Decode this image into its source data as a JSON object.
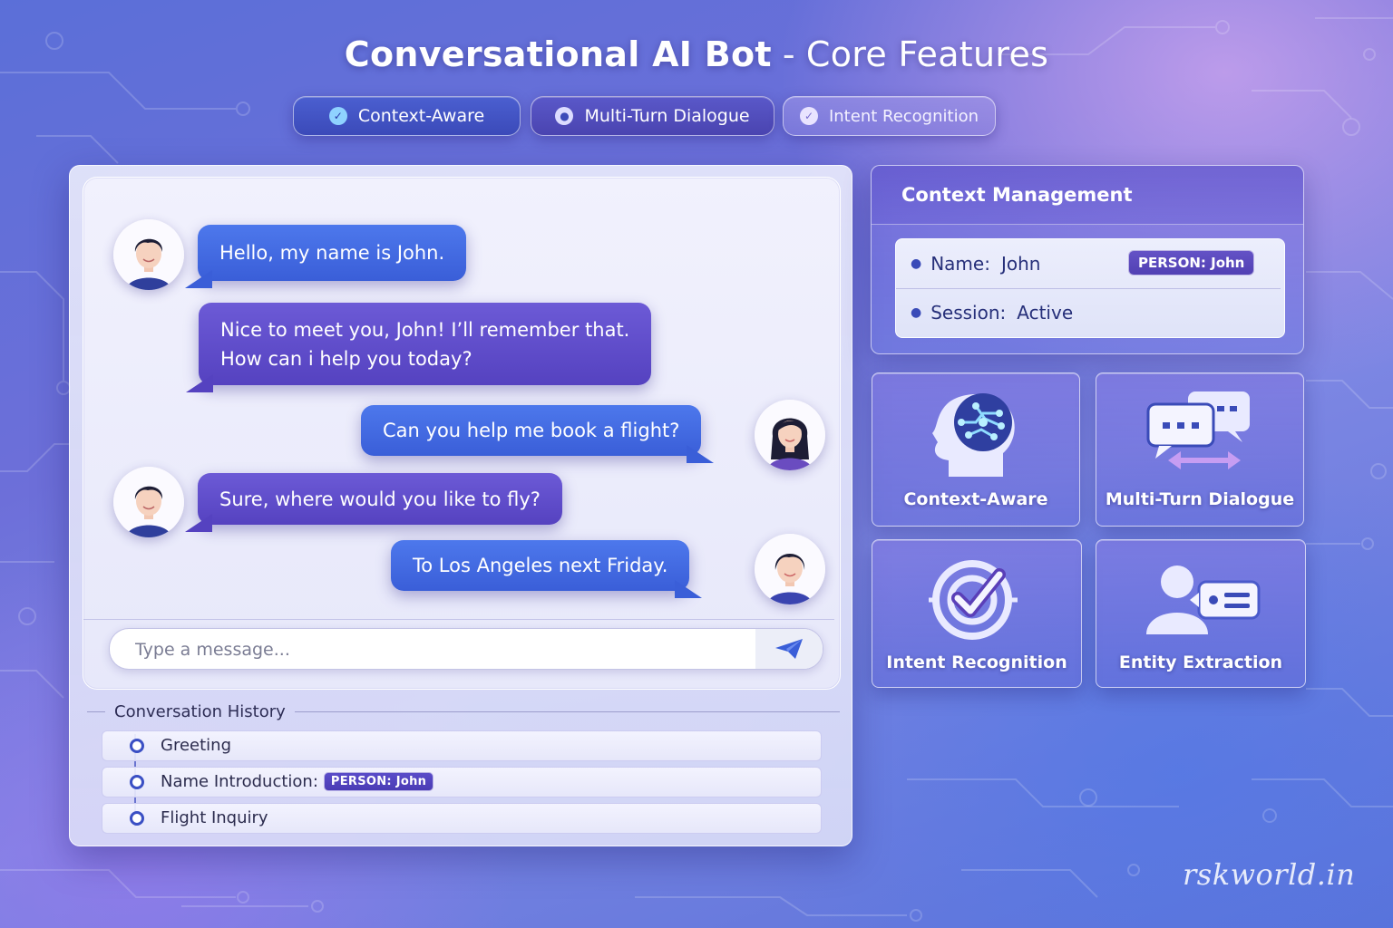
{
  "header": {
    "title_main": "Conversational AI Bot",
    "title_separator": "-",
    "title_sub": "Core Features"
  },
  "tags": [
    {
      "label": "Context-Aware",
      "icon": "check-circle-icon"
    },
    {
      "label": "Multi-Turn Dialogue",
      "icon": "dot-circle-icon"
    },
    {
      "label": "Intent Recognition",
      "icon": "check-circle-icon"
    }
  ],
  "chat": {
    "messages": [
      {
        "sender": "user",
        "avatar": "male-avatar-icon",
        "text": "Hello, my name is John."
      },
      {
        "sender": "bot",
        "lines": [
          "Nice to meet you, John! I’ll remember that.",
          "How can i help you today?"
        ]
      },
      {
        "sender": "user",
        "avatar": "female-avatar-icon",
        "text": "Can you help me book a flight?"
      },
      {
        "sender": "bot",
        "avatar": "male-avatar-icon",
        "text": "Sure, where would you like to fly?"
      },
      {
        "sender": "user",
        "avatar": "female-avatar-icon",
        "text": "To Los Angeles next Friday."
      }
    ],
    "input": {
      "placeholder": "Type a message...",
      "value": ""
    },
    "send_icon": "paper-plane-icon"
  },
  "history": {
    "title": "Conversation History",
    "items": [
      {
        "label": "Greeting",
        "badge": ""
      },
      {
        "label": "Name Introduction:",
        "badge": "PERSON: John"
      },
      {
        "label": "Flight Inquiry",
        "badge": ""
      }
    ]
  },
  "context": {
    "title": "Context Management",
    "rows": [
      {
        "label": "Name:",
        "value": "John",
        "badge": "PERSON: John"
      },
      {
        "label": "Session:",
        "value": "Active"
      }
    ]
  },
  "features": [
    {
      "label": "Context-Aware",
      "icon": "brain-head-icon"
    },
    {
      "label": "Multi-Turn Dialogue",
      "icon": "chat-bubbles-icon"
    },
    {
      "label": "Intent Recognition",
      "icon": "target-check-icon"
    },
    {
      "label": "Entity Extraction",
      "icon": "person-card-icon"
    }
  ],
  "watermark": "rskworld.in",
  "colors": {
    "user_bubble": "#3a5ed8",
    "bot_bubble": "#5542c0",
    "badge": "#5140b3",
    "accent_blue": "#3a4fc4"
  }
}
